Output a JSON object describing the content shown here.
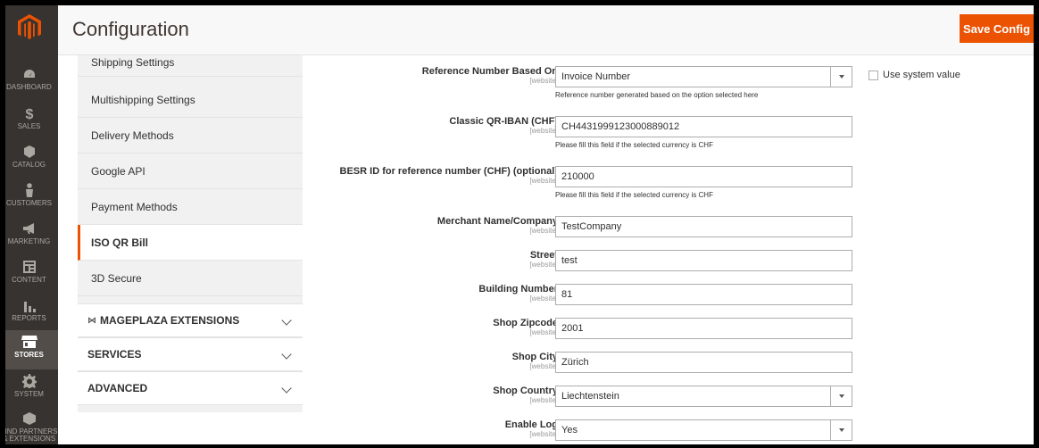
{
  "page": {
    "title": "Configuration",
    "save_label": "Save Config"
  },
  "nav": {
    "items": [
      {
        "label": "DASHBOARD"
      },
      {
        "label": "SALES"
      },
      {
        "label": "CATALOG"
      },
      {
        "label": "CUSTOMERS"
      },
      {
        "label": "MARKETING"
      },
      {
        "label": "CONTENT"
      },
      {
        "label": "REPORTS"
      },
      {
        "label": "STORES"
      },
      {
        "label": "SYSTEM"
      },
      {
        "label": "FIND PARTNERS",
        "label2": "& EXTENSIONS"
      }
    ]
  },
  "tabs": {
    "items": [
      {
        "label": "Shipping Settings"
      },
      {
        "label": "Multishipping Settings"
      },
      {
        "label": "Delivery Methods"
      },
      {
        "label": "Google API"
      },
      {
        "label": "Payment Methods"
      },
      {
        "label": "ISO QR Bill"
      },
      {
        "label": "3D Secure"
      }
    ],
    "groups": [
      {
        "label": "MAGEPLAZA EXTENSIONS"
      },
      {
        "label": "SERVICES"
      },
      {
        "label": "ADVANCED"
      }
    ]
  },
  "form": {
    "scope": "[website]",
    "use_system_value": "Use system value",
    "fields": [
      {
        "label": "Reference Number Based On",
        "value": "Invoice Number",
        "note": "Reference number generated based on the option selected here"
      },
      {
        "label": "Classic QR-IBAN (CHF)",
        "value": "CH4431999123000889012",
        "note": "Please fill this field if the selected currency is CHF"
      },
      {
        "label": "BESR ID for reference number (CHF) (optional)",
        "value": "210000",
        "note": "Please fill this field if the selected currency is CHF"
      },
      {
        "label": "Merchant Name/Company",
        "value": "TestCompany"
      },
      {
        "label": "Street",
        "value": "test"
      },
      {
        "label": "Building Number",
        "value": "81"
      },
      {
        "label": "Shop Zipcode",
        "value": "2001"
      },
      {
        "label": "Shop City",
        "value": "Zürich"
      },
      {
        "label": "Shop Country",
        "value": "Liechtenstein"
      },
      {
        "label": "Enable Log",
        "value": "Yes"
      }
    ]
  },
  "colors": {
    "accent": "#eb5202",
    "nav_bg": "#373330",
    "tabs_bg": "#f1f1f1"
  }
}
